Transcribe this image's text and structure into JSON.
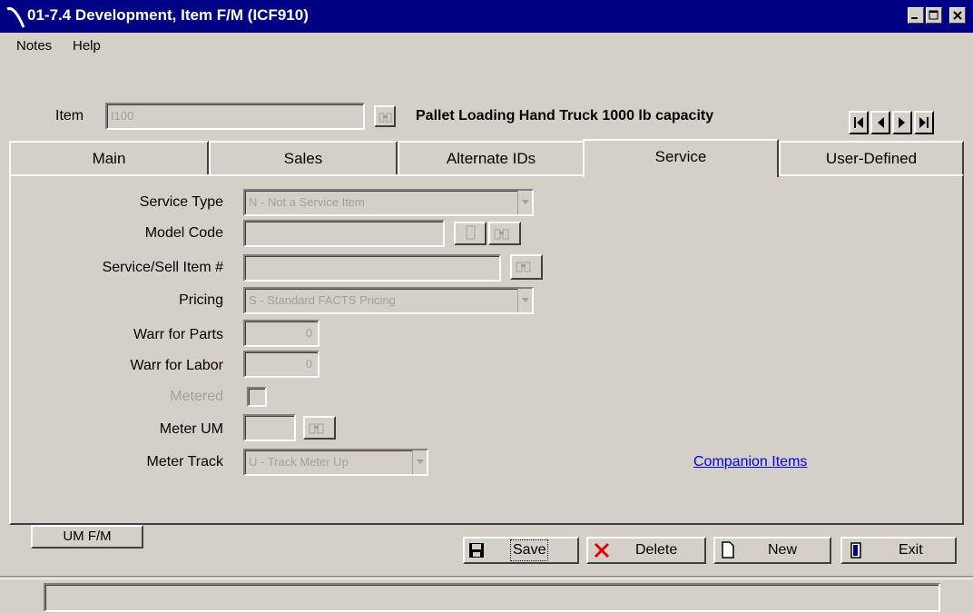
{
  "window": {
    "title": "01-7.4 Development, Item F/M (ICF910)"
  },
  "menu": {
    "items": [
      {
        "label": "Notes"
      },
      {
        "label": "Help"
      }
    ]
  },
  "item": {
    "label": "Item",
    "value": "I100",
    "description": "Pallet Loading Hand Truck 1000 lb capacity"
  },
  "nav": {
    "first": "first-record-icon",
    "prev": "previous-record-icon",
    "next": "next-record-icon",
    "last": "last-record-icon"
  },
  "tabs": [
    {
      "label": "Main",
      "active": false
    },
    {
      "label": "Sales",
      "active": false
    },
    {
      "label": "Alternate IDs",
      "active": false
    },
    {
      "label": "Service",
      "active": true
    },
    {
      "label": "User-Defined",
      "active": false
    }
  ],
  "service": {
    "service_type": {
      "label": "Service Type",
      "value": "N - Not a Service Item"
    },
    "model_code": {
      "label": "Model Code",
      "value": ""
    },
    "service_sell_item": {
      "label": "Service/Sell Item #",
      "value": ""
    },
    "pricing": {
      "label": "Pricing",
      "value": "S - Standard FACTS Pricing"
    },
    "warr_parts": {
      "label": "Warr for Parts",
      "value": "0"
    },
    "warr_labor": {
      "label": "Warr for Labor",
      "value": "0"
    },
    "metered": {
      "label": "Metered",
      "checked": false
    },
    "meter_um": {
      "label": "Meter UM",
      "value": ""
    },
    "meter_track": {
      "label": "Meter Track",
      "value": "U - Track Meter Up"
    },
    "companion_link": "Companion Items"
  },
  "buttons": {
    "um_fm": "UM F/M",
    "save": "Save",
    "delete": "Delete",
    "new": "New",
    "exit": "Exit"
  },
  "colors": {
    "titlebar": "#000084",
    "face": "#d4d0c8",
    "link": "#0000ee"
  }
}
